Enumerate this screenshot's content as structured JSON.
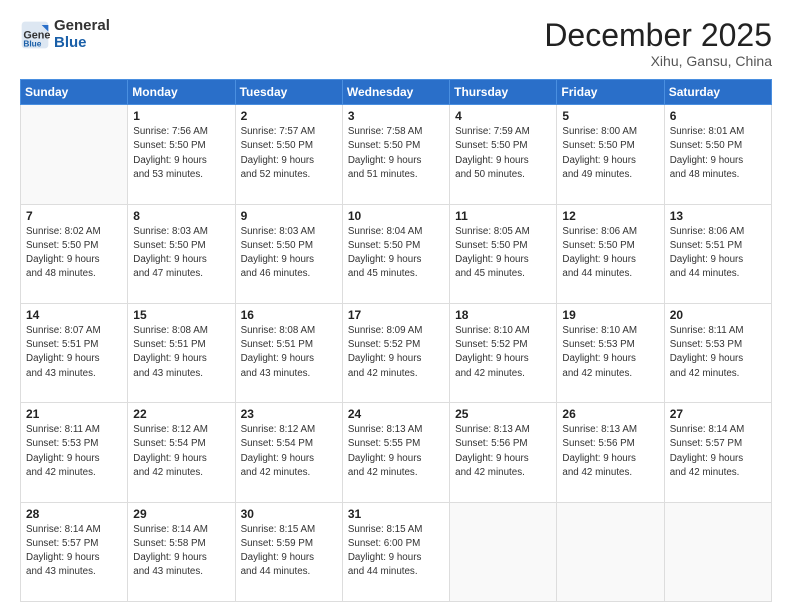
{
  "header": {
    "logo_line1": "General",
    "logo_line2": "Blue",
    "month": "December 2025",
    "location": "Xihu, Gansu, China"
  },
  "weekdays": [
    "Sunday",
    "Monday",
    "Tuesday",
    "Wednesday",
    "Thursday",
    "Friday",
    "Saturday"
  ],
  "weeks": [
    [
      {
        "day": "",
        "info": ""
      },
      {
        "day": "1",
        "info": "Sunrise: 7:56 AM\nSunset: 5:50 PM\nDaylight: 9 hours\nand 53 minutes."
      },
      {
        "day": "2",
        "info": "Sunrise: 7:57 AM\nSunset: 5:50 PM\nDaylight: 9 hours\nand 52 minutes."
      },
      {
        "day": "3",
        "info": "Sunrise: 7:58 AM\nSunset: 5:50 PM\nDaylight: 9 hours\nand 51 minutes."
      },
      {
        "day": "4",
        "info": "Sunrise: 7:59 AM\nSunset: 5:50 PM\nDaylight: 9 hours\nand 50 minutes."
      },
      {
        "day": "5",
        "info": "Sunrise: 8:00 AM\nSunset: 5:50 PM\nDaylight: 9 hours\nand 49 minutes."
      },
      {
        "day": "6",
        "info": "Sunrise: 8:01 AM\nSunset: 5:50 PM\nDaylight: 9 hours\nand 48 minutes."
      }
    ],
    [
      {
        "day": "7",
        "info": "Sunrise: 8:02 AM\nSunset: 5:50 PM\nDaylight: 9 hours\nand 48 minutes."
      },
      {
        "day": "8",
        "info": "Sunrise: 8:03 AM\nSunset: 5:50 PM\nDaylight: 9 hours\nand 47 minutes."
      },
      {
        "day": "9",
        "info": "Sunrise: 8:03 AM\nSunset: 5:50 PM\nDaylight: 9 hours\nand 46 minutes."
      },
      {
        "day": "10",
        "info": "Sunrise: 8:04 AM\nSunset: 5:50 PM\nDaylight: 9 hours\nand 45 minutes."
      },
      {
        "day": "11",
        "info": "Sunrise: 8:05 AM\nSunset: 5:50 PM\nDaylight: 9 hours\nand 45 minutes."
      },
      {
        "day": "12",
        "info": "Sunrise: 8:06 AM\nSunset: 5:50 PM\nDaylight: 9 hours\nand 44 minutes."
      },
      {
        "day": "13",
        "info": "Sunrise: 8:06 AM\nSunset: 5:51 PM\nDaylight: 9 hours\nand 44 minutes."
      }
    ],
    [
      {
        "day": "14",
        "info": "Sunrise: 8:07 AM\nSunset: 5:51 PM\nDaylight: 9 hours\nand 43 minutes."
      },
      {
        "day": "15",
        "info": "Sunrise: 8:08 AM\nSunset: 5:51 PM\nDaylight: 9 hours\nand 43 minutes."
      },
      {
        "day": "16",
        "info": "Sunrise: 8:08 AM\nSunset: 5:51 PM\nDaylight: 9 hours\nand 43 minutes."
      },
      {
        "day": "17",
        "info": "Sunrise: 8:09 AM\nSunset: 5:52 PM\nDaylight: 9 hours\nand 42 minutes."
      },
      {
        "day": "18",
        "info": "Sunrise: 8:10 AM\nSunset: 5:52 PM\nDaylight: 9 hours\nand 42 minutes."
      },
      {
        "day": "19",
        "info": "Sunrise: 8:10 AM\nSunset: 5:53 PM\nDaylight: 9 hours\nand 42 minutes."
      },
      {
        "day": "20",
        "info": "Sunrise: 8:11 AM\nSunset: 5:53 PM\nDaylight: 9 hours\nand 42 minutes."
      }
    ],
    [
      {
        "day": "21",
        "info": "Sunrise: 8:11 AM\nSunset: 5:53 PM\nDaylight: 9 hours\nand 42 minutes."
      },
      {
        "day": "22",
        "info": "Sunrise: 8:12 AM\nSunset: 5:54 PM\nDaylight: 9 hours\nand 42 minutes."
      },
      {
        "day": "23",
        "info": "Sunrise: 8:12 AM\nSunset: 5:54 PM\nDaylight: 9 hours\nand 42 minutes."
      },
      {
        "day": "24",
        "info": "Sunrise: 8:13 AM\nSunset: 5:55 PM\nDaylight: 9 hours\nand 42 minutes."
      },
      {
        "day": "25",
        "info": "Sunrise: 8:13 AM\nSunset: 5:56 PM\nDaylight: 9 hours\nand 42 minutes."
      },
      {
        "day": "26",
        "info": "Sunrise: 8:13 AM\nSunset: 5:56 PM\nDaylight: 9 hours\nand 42 minutes."
      },
      {
        "day": "27",
        "info": "Sunrise: 8:14 AM\nSunset: 5:57 PM\nDaylight: 9 hours\nand 42 minutes."
      }
    ],
    [
      {
        "day": "28",
        "info": "Sunrise: 8:14 AM\nSunset: 5:57 PM\nDaylight: 9 hours\nand 43 minutes."
      },
      {
        "day": "29",
        "info": "Sunrise: 8:14 AM\nSunset: 5:58 PM\nDaylight: 9 hours\nand 43 minutes."
      },
      {
        "day": "30",
        "info": "Sunrise: 8:15 AM\nSunset: 5:59 PM\nDaylight: 9 hours\nand 44 minutes."
      },
      {
        "day": "31",
        "info": "Sunrise: 8:15 AM\nSunset: 6:00 PM\nDaylight: 9 hours\nand 44 minutes."
      },
      {
        "day": "",
        "info": ""
      },
      {
        "day": "",
        "info": ""
      },
      {
        "day": "",
        "info": ""
      }
    ]
  ]
}
